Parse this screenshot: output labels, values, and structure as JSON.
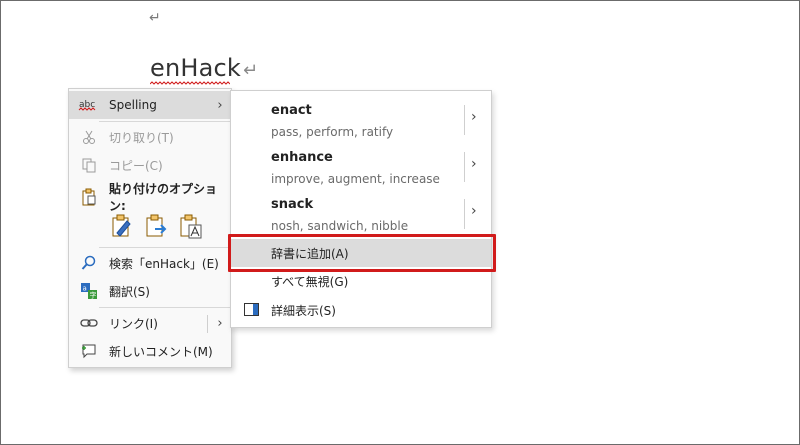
{
  "document": {
    "paragraph_mark_top": "↵",
    "misspelled_word": "enHack",
    "paragraph_mark": "↵"
  },
  "context_menu": {
    "spelling": {
      "icon_text": "abc",
      "label": "Spelling",
      "chevron": "›"
    },
    "cut": {
      "label": "切り取り(T)"
    },
    "copy": {
      "label": "コピー(C)"
    },
    "paste_options": {
      "label": "貼り付けのオプション:"
    },
    "search": {
      "label": "検索「enHack」(E)"
    },
    "translate": {
      "label": "翻訳(S)"
    },
    "link": {
      "label": "リンク(I)",
      "chevron": "›"
    },
    "new_comment": {
      "label": "新しいコメント(M)"
    }
  },
  "spelling_submenu": {
    "suggestions": [
      {
        "word": "enact",
        "synonyms": "pass, perform, ratify",
        "chevron": "›"
      },
      {
        "word": "enhance",
        "synonyms": "improve, augment, increase",
        "chevron": "›"
      },
      {
        "word": "snack",
        "synonyms": "nosh, sandwich, nibble",
        "chevron": "›"
      }
    ],
    "add_to_dictionary": {
      "label": "辞書に追加(A)"
    },
    "ignore_all": {
      "label": "すべて無視(G)"
    },
    "see_more": {
      "label": "詳細表示(S)"
    }
  },
  "colors": {
    "highlight_box": "#d11b1b",
    "hover_bg": "#dcdcdc",
    "squiggle": "#d11b1b"
  }
}
